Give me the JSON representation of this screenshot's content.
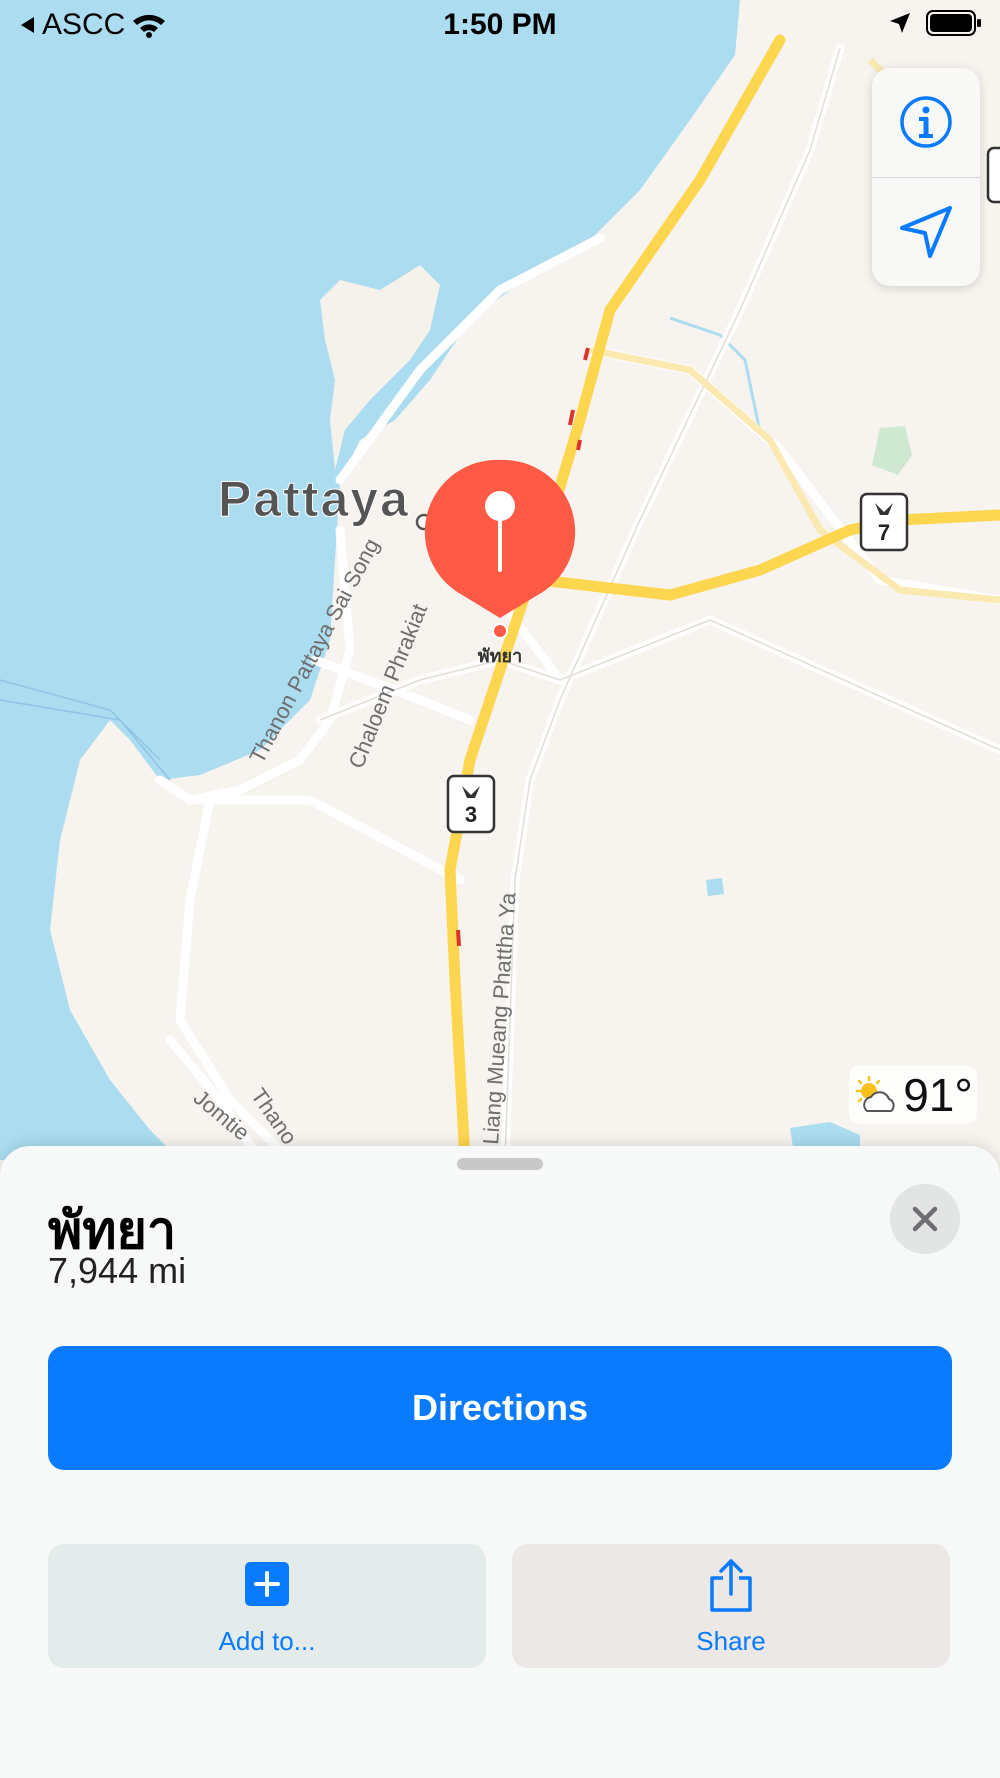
{
  "status_bar": {
    "back_app": "ASCC",
    "time": "1:50 PM",
    "icons": [
      "back-arrow-icon",
      "wifi-icon",
      "location-arrow-icon",
      "battery-icon"
    ]
  },
  "map": {
    "city_label": "Pattaya",
    "pin_label": "พัทยา",
    "streets": [
      "Thanon Pattaya Sai Song",
      "Chaloem Phrakiat",
      "Liang Mueang Phattha Ya",
      "Jomtie",
      "Thano"
    ],
    "highway_shields": [
      "7",
      "3"
    ],
    "colors": {
      "water": "#abdcf0",
      "land": "#f7f3ee",
      "highway": "#fdd64f",
      "pin": "#fe5a45",
      "park": "#cfe8d2"
    }
  },
  "map_controls": {
    "info_icon": "info-icon",
    "location_icon": "navigation-arrow-icon"
  },
  "weather": {
    "icon": "partly-sunny-icon",
    "temperature": "91°"
  },
  "place_card": {
    "title": "พัทยา",
    "distance": "7,944 mi",
    "directions_label": "Directions",
    "add_label": "Add to...",
    "share_label": "Share",
    "accent_color": "#0a7bfe"
  }
}
